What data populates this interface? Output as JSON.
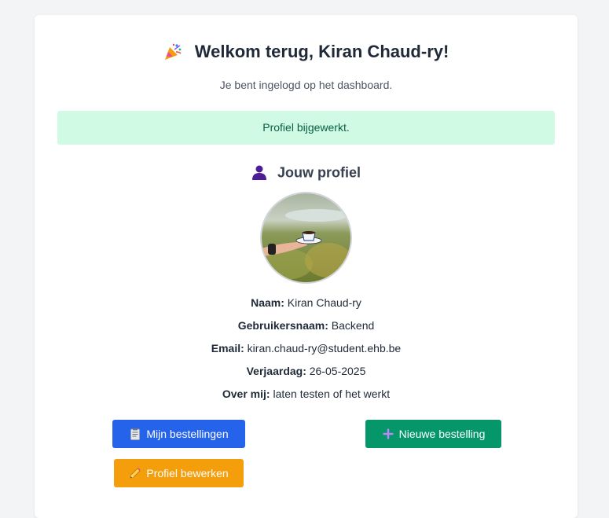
{
  "header": {
    "title": "Welkom terug, Kiran Chaud-ry!",
    "subtitle": "Je bent ingelogd op het dashboard.",
    "title_icon": "party-popper-icon"
  },
  "alert": {
    "message": "Profiel bijgewerkt.",
    "color": "#d1fae5"
  },
  "profile": {
    "heading": "Jouw profiel",
    "heading_icon": "user-silhouette-icon",
    "fields": [
      {
        "label": "Naam:",
        "value": "Kiran Chaud-ry"
      },
      {
        "label": "Gebruikersnaam:",
        "value": "Backend"
      },
      {
        "label": "Email:",
        "value": "kiran.chaud-ry@student.ehb.be"
      },
      {
        "label": "Verjaardag:",
        "value": "26-05-2025"
      },
      {
        "label": "Over mij:",
        "value": "laten testen of het werkt"
      }
    ]
  },
  "actions": {
    "orders_label": "Mijn bestellingen",
    "new_order_label": "Nieuwe bestelling",
    "edit_profile_label": "Profiel bewerken",
    "colors": {
      "blue": "#2563eb",
      "green": "#059669",
      "orange": "#f59e0b"
    }
  }
}
